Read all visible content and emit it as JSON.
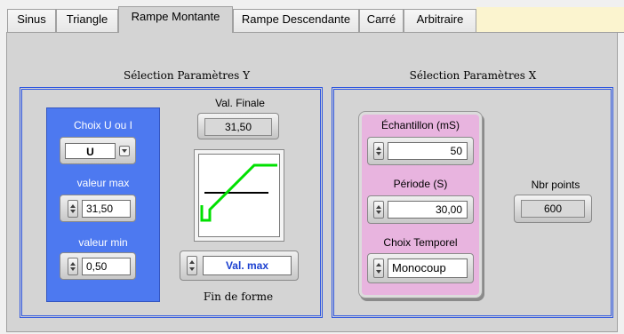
{
  "tabs": [
    {
      "label": "Sinus"
    },
    {
      "label": "Triangle"
    },
    {
      "label": "Rampe Montante"
    },
    {
      "label": "Rampe Descendante"
    },
    {
      "label": "Carré"
    },
    {
      "label": "Arbitraire"
    }
  ],
  "active_tab": "Rampe Montante",
  "y_section": {
    "title": "Sélection Paramètres Y",
    "choix_label": "Choix U ou I",
    "choix_value": "U",
    "valeur_max_label": "valeur max",
    "valeur_max_value": "31,50",
    "valeur_min_label": "valeur min",
    "valeur_min_value": "0,50",
    "val_finale_label": "Val. Finale",
    "val_finale_value": "31,50",
    "fin_select_value": "Val. max",
    "fin_label": "Fin de forme"
  },
  "x_section": {
    "title": "Sélection Paramètres X",
    "echantillon_label": "Échantillon (mS)",
    "echantillon_value": "50",
    "periode_label": "Période (S)",
    "periode_value": "30,00",
    "choix_temporel_label": "Choix Temporel",
    "choix_temporel_value": "Monocoup",
    "nbr_points_label": "Nbr points",
    "nbr_points_value": "600"
  },
  "colors": {
    "frame_blue": "#2f57e0",
    "panel_blue": "#4d79f0",
    "panel_pink": "#e8b4df",
    "ramp_green": "#00e000",
    "select_text_blue": "#1a3fd0"
  }
}
